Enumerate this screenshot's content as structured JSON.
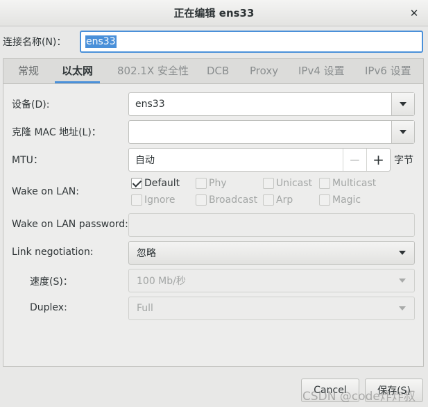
{
  "window": {
    "title": "正在编辑 ens33",
    "close_glyph": "✕"
  },
  "connection_name": {
    "label": "连接名称(N)：",
    "value": "ens33"
  },
  "tabs": [
    {
      "label": "常规"
    },
    {
      "label": "以太网"
    },
    {
      "label": "802.1X 安全性"
    },
    {
      "label": "DCB"
    },
    {
      "label": "Proxy"
    },
    {
      "label": "IPv4 设置"
    },
    {
      "label": "IPv6 设置"
    }
  ],
  "active_tab": "以太网",
  "ethernet": {
    "device": {
      "label": "设备(D):",
      "value": "ens33"
    },
    "cloned_mac": {
      "label": "克隆 MAC 地址(L)：",
      "value": ""
    },
    "mtu": {
      "label": "MTU：",
      "value": "自动",
      "minus": "−",
      "plus": "+",
      "unit": "字节"
    },
    "wol": {
      "label": "Wake on LAN:",
      "options": [
        {
          "label": "Default",
          "checked": true
        },
        {
          "label": "Phy",
          "checked": false
        },
        {
          "label": "Unicast",
          "checked": false
        },
        {
          "label": "Multicast",
          "checked": false
        },
        {
          "label": "Ignore",
          "checked": false
        },
        {
          "label": "Broadcast",
          "checked": false
        },
        {
          "label": "Arp",
          "checked": false
        },
        {
          "label": "Magic",
          "checked": false
        }
      ]
    },
    "wol_password": {
      "label": "Wake on LAN password:",
      "value": ""
    },
    "link_negotiation": {
      "label": "Link negotiation:",
      "value": "忽略"
    },
    "speed": {
      "label": "速度(S)：",
      "value": "100 Mb/秒"
    },
    "duplex": {
      "label": "Duplex:",
      "value": "Full"
    }
  },
  "buttons": {
    "cancel": "Cancel",
    "save": "保存(S)"
  },
  "watermark": "CSDN @code炸炸叔",
  "colors": {
    "accent": "#4a90d9",
    "window_bg": "#e8e8e7"
  }
}
